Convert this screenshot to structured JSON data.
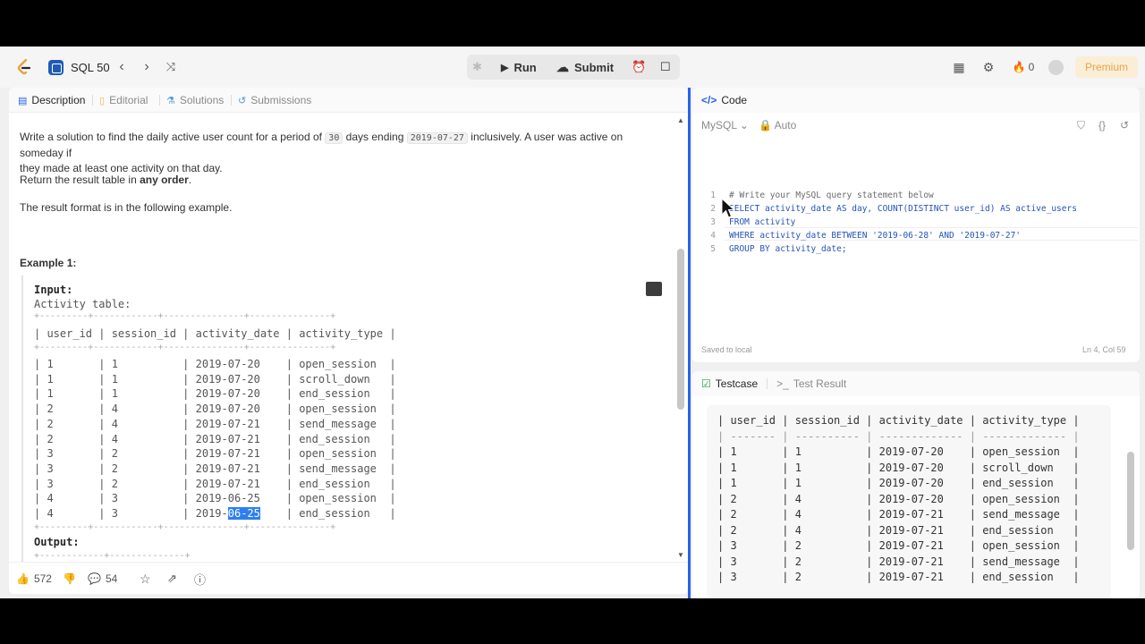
{
  "topbar": {
    "list_label": "SQL 50",
    "run_label": "Run",
    "submit_label": "Submit",
    "points": "0",
    "premium_label": "Premium"
  },
  "left_tabs": [
    "Description",
    "Editorial",
    "Solutions",
    "Submissions"
  ],
  "description": {
    "para1_a": "Write a solution to find the daily active user count for a period of ",
    "para1_code1": "30",
    "para1_b": " days ending ",
    "para1_code2": "2019-07-27",
    "para1_c": " inclusively. A user was active on someday if",
    "para1_line2": "they made at least one activity on that day.",
    "para2_a": "Return the result table in ",
    "para2_bold": "any order",
    "para2_b": ".",
    "para3": "The result format is in the following example.",
    "example_title": "Example 1:"
  },
  "example": {
    "input_label": "Input:",
    "table_label": "Activity table:",
    "border_line": "+---------+------------+---------------+---------------+",
    "header_line": "| user_id | session_id | activity_date | activity_type |",
    "rows": [
      "| 1       | 1          | 2019-07-20    | open_session  |",
      "| 1       | 1          | 2019-07-20    | scroll_down   |",
      "| 1       | 1          | 2019-07-20    | end_session   |",
      "| 2       | 4          | 2019-07-20    | open_session  |",
      "| 2       | 4          | 2019-07-21    | send_message  |",
      "| 2       | 4          | 2019-07-21    | end_session   |",
      "| 3       | 2          | 2019-07-21    | open_session  |",
      "| 3       | 2          | 2019-07-21    | send_message  |",
      "| 3       | 2          | 2019-07-21    | end_session   |",
      "| 4       | 3          | 2019-06-25    | open_session  |"
    ],
    "last_row_a": "| 4       | 3          | 2019-",
    "last_row_hl": "06-25",
    "last_row_b": "    | end_session   |",
    "output_label": "Output:",
    "output_border": "+------------+--------------+"
  },
  "bottom_bar": {
    "likes": "572",
    "comments": "54"
  },
  "code_panel": {
    "title": "Code",
    "language": "MySQL",
    "mode": "Auto",
    "saved": "Saved to local",
    "position": "Ln 4, Col 59",
    "lines": [
      {
        "num": "1",
        "text": "# Write your MySQL query statement below"
      },
      {
        "num": "2",
        "text": "SELECT activity_date AS day, COUNT(DISTINCT user_id) AS active_users"
      },
      {
        "num": "3",
        "text": "FROM activity"
      },
      {
        "num": "4",
        "text": "WHERE activity_date BETWEEN '2019-06-28' AND '2019-07-27'"
      },
      {
        "num": "5",
        "text": "GROUP BY activity_date;"
      }
    ]
  },
  "testcase_panel": {
    "tab_testcase": "Testcase",
    "tab_result": "Test Result",
    "header_line": "| user_id | session_id | activity_date | activity_type |",
    "sep_line": "| ------- | ---------- | ------------- | ------------- |",
    "rows": [
      "| 1       | 1          | 2019-07-20    | open_session  |",
      "| 1       | 1          | 2019-07-20    | scroll_down   |",
      "| 1       | 1          | 2019-07-20    | end_session   |",
      "| 2       | 4          | 2019-07-20    | open_session  |",
      "| 2       | 4          | 2019-07-21    | send_message  |",
      "| 2       | 4          | 2019-07-21    | end_session   |",
      "| 3       | 2          | 2019-07-21    | open_session  |",
      "| 3       | 2          | 2019-07-21    | send_message  |",
      "| 3       | 2          | 2019-07-21    | end_session   |"
    ]
  }
}
